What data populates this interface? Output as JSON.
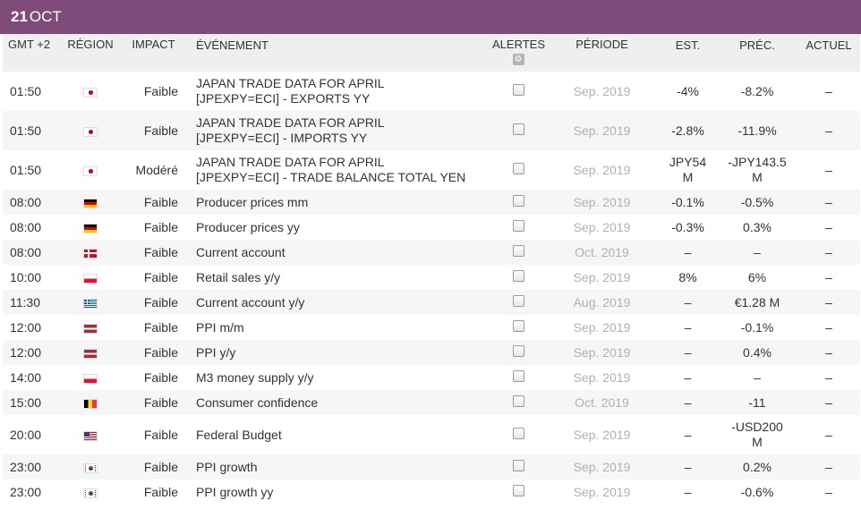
{
  "header": {
    "day": "21",
    "month": "OCT"
  },
  "columns": {
    "time": "GMT +2",
    "region": "RÉGION",
    "impact": "IMPACT",
    "event": "ÉVÉNEMENT",
    "alerts": "ALERTES",
    "period": "PÉRIODE",
    "est": "EST.",
    "prev": "PRÉC.",
    "actual": "ACTUEL"
  },
  "icons": {
    "alerts_settings": "gear-icon"
  },
  "rows": [
    {
      "time": "01:50",
      "flag": "jp",
      "impact": "Faible",
      "event1": "JAPAN TRADE DATA FOR APRIL",
      "event2": "[JPEXPY=ECI] - EXPORTS YY",
      "period": "Sep. 2019",
      "est": "-4%",
      "est2": "",
      "prev": "-8.2%",
      "prev2": "",
      "actual": "–"
    },
    {
      "time": "01:50",
      "flag": "jp",
      "impact": "Faible",
      "event1": "JAPAN TRADE DATA FOR APRIL",
      "event2": "[JPEXPY=ECI] - IMPORTS YY",
      "period": "Sep. 2019",
      "est": "-2.8%",
      "est2": "",
      "prev": "-11.9%",
      "prev2": "",
      "actual": "–"
    },
    {
      "time": "01:50",
      "flag": "jp",
      "impact": "Modéré",
      "event1": "JAPAN TRADE DATA FOR APRIL",
      "event2": "[JPEXPY=ECI] - TRADE BALANCE TOTAL YEN",
      "period": "Sep. 2019",
      "est": "JPY54",
      "est2": "M",
      "prev": "-JPY143.5",
      "prev2": "M",
      "actual": "–"
    },
    {
      "time": "08:00",
      "flag": "de",
      "impact": "Faible",
      "event1": "Producer prices mm",
      "event2": "",
      "period": "Sep. 2019",
      "est": "-0.1%",
      "est2": "",
      "prev": "-0.5%",
      "prev2": "",
      "actual": "–"
    },
    {
      "time": "08:00",
      "flag": "de",
      "impact": "Faible",
      "event1": "Producer prices yy",
      "event2": "",
      "period": "Sep. 2019",
      "est": "-0.3%",
      "est2": "",
      "prev": "0.3%",
      "prev2": "",
      "actual": "–"
    },
    {
      "time": "08:00",
      "flag": "dk",
      "impact": "Faible",
      "event1": "Current account",
      "event2": "",
      "period": "Oct. 2019",
      "est": "–",
      "est2": "",
      "prev": "–",
      "prev2": "",
      "actual": "–"
    },
    {
      "time": "10:00",
      "flag": "pl",
      "impact": "Faible",
      "event1": "Retail sales y/y",
      "event2": "",
      "period": "Sep. 2019",
      "est": "8%",
      "est2": "",
      "prev": "6%",
      "prev2": "",
      "actual": "–"
    },
    {
      "time": "11:30",
      "flag": "gr",
      "impact": "Faible",
      "event1": "Current account y/y",
      "event2": "",
      "period": "Aug. 2019",
      "est": "–",
      "est2": "",
      "prev": "€1.28 M",
      "prev2": "",
      "actual": "–"
    },
    {
      "time": "12:00",
      "flag": "lv",
      "impact": "Faible",
      "event1": "PPI m/m",
      "event2": "",
      "period": "Sep. 2019",
      "est": "–",
      "est2": "",
      "prev": "-0.1%",
      "prev2": "",
      "actual": "–"
    },
    {
      "time": "12:00",
      "flag": "lv",
      "impact": "Faible",
      "event1": "PPI y/y",
      "event2": "",
      "period": "Sep. 2019",
      "est": "–",
      "est2": "",
      "prev": "0.4%",
      "prev2": "",
      "actual": "–"
    },
    {
      "time": "14:00",
      "flag": "pl",
      "impact": "Faible",
      "event1": "M3 money supply y/y",
      "event2": "",
      "period": "Sep. 2019",
      "est": "–",
      "est2": "",
      "prev": "–",
      "prev2": "",
      "actual": "–"
    },
    {
      "time": "15:00",
      "flag": "be",
      "impact": "Faible",
      "event1": "Consumer confidence",
      "event2": "",
      "period": "Oct. 2019",
      "est": "–",
      "est2": "",
      "prev": "-11",
      "prev2": "",
      "actual": "–"
    },
    {
      "time": "20:00",
      "flag": "us",
      "impact": "Faible",
      "event1": "Federal Budget",
      "event2": "",
      "period": "Sep. 2019",
      "est": "–",
      "est2": "",
      "prev": "-USD200",
      "prev2": "M",
      "actual": "–"
    },
    {
      "time": "23:00",
      "flag": "kr",
      "impact": "Faible",
      "event1": "PPI growth",
      "event2": "",
      "period": "Sep. 2019",
      "est": "–",
      "est2": "",
      "prev": "0.2%",
      "prev2": "",
      "actual": "–"
    },
    {
      "time": "23:00",
      "flag": "kr",
      "impact": "Faible",
      "event1": "PPI growth yy",
      "event2": "",
      "period": "Sep. 2019",
      "est": "–",
      "est2": "",
      "prev": "-0.6%",
      "prev2": "",
      "actual": "–"
    }
  ]
}
